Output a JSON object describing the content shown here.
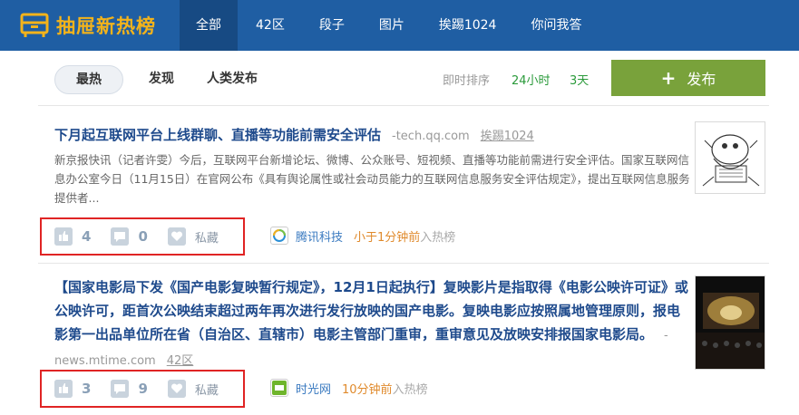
{
  "brand": {
    "name": "抽屉新热榜"
  },
  "nav": {
    "items": [
      {
        "label": "全部"
      },
      {
        "label": "42区"
      },
      {
        "label": "段子"
      },
      {
        "label": "图片"
      },
      {
        "label": "挨踢1024"
      },
      {
        "label": "你问我答"
      }
    ],
    "active_index": 0
  },
  "filters": {
    "hot": "最热",
    "discover": "发现",
    "human_publish": "人类发布",
    "sort_label": "即时排序",
    "sort_24h": "24小时",
    "sort_3d": "3天",
    "publish_button": "发布"
  },
  "items": [
    {
      "title": "下月起互联网平台上线群聊、直播等功能前需安全评估",
      "domain": "-tech.qq.com",
      "zone": "挨踢1024",
      "body": "新京报快讯（记者许雯）今后，互联网平台新增论坛、微博、公众账号、短视频、直播等功能前需进行安全评估。国家互联网信息办公室今日（11月15日）在官网公布《具有舆论属性或社会动员能力的互联网信息服务安全评估规定》，提出互联网信息服务提供者...",
      "likes": "4",
      "comments": "0",
      "favorite": "私藏",
      "source_name": "腾讯科技",
      "time": "小于1分钟前",
      "time_suffix": "入热榜"
    },
    {
      "title": "【国家电影局下发《国产电影复映暂行规定》，12月1日起执行】复映影片是指取得《电影公映许可证》或公映许可，距首次公映结束超过两年再次进行发行放映的国产电影。复映电影应按照属地管理原则，报电影第一出品单位所在省（自治区、直辖市）电影主管部门重审，重审意见及放映安排报国家电影局。",
      "domain": "-news.mtime.com",
      "zone": "42区",
      "likes": "3",
      "comments": "9",
      "favorite": "私藏",
      "source_name": "时光网",
      "time": "10分钟前",
      "time_suffix": "入热榜"
    }
  ],
  "colors": {
    "topbar": "#1f5ea3",
    "brand": "#f3b31b",
    "title": "#1e4a8c",
    "publish": "#79a23b",
    "highlight_box": "#e02424",
    "time": "#e08a2c"
  }
}
